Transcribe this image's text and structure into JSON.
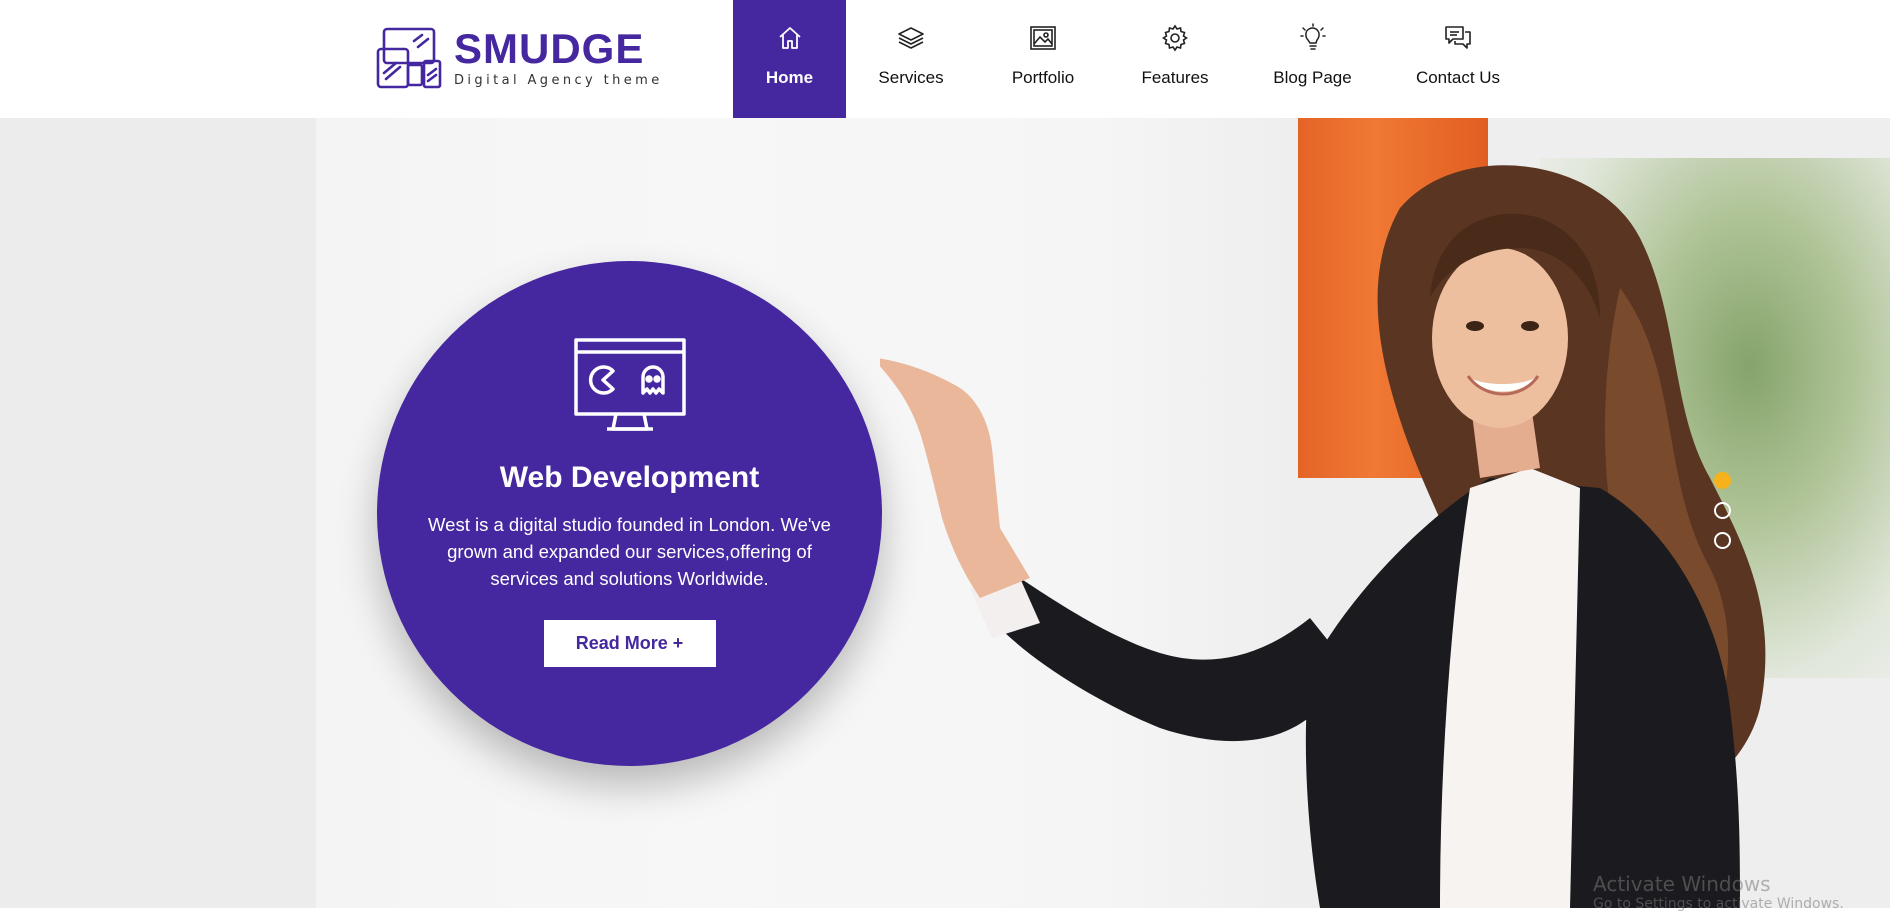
{
  "logo": {
    "name": "SMUDGE",
    "tagline": "Digital Agency theme"
  },
  "nav": {
    "items": [
      {
        "label": "Home",
        "icon": "home-icon",
        "active": true
      },
      {
        "label": "Services",
        "icon": "layers-icon",
        "active": false
      },
      {
        "label": "Portfolio",
        "icon": "image-icon",
        "active": false
      },
      {
        "label": "Features",
        "icon": "gear-icon",
        "active": false
      },
      {
        "label": "Blog Page",
        "icon": "lightbulb-icon",
        "active": false
      },
      {
        "label": "Contact Us",
        "icon": "chat-icon",
        "active": false
      }
    ]
  },
  "hero": {
    "card": {
      "icon": "monitor-game-icon",
      "title": "Web Development",
      "text": "West is a digital studio founded in London. We've grown and expanded our services,offering of services and solutions Worldwide.",
      "button_label": "Read More +"
    },
    "slider": {
      "slides": 3,
      "active_index": 0
    }
  },
  "watermark": {
    "title": "Activate Windows",
    "subtitle": "Go to Settings to activate Windows."
  },
  "colors": {
    "brand": "#45279f",
    "accent": "#f6b21a",
    "pillar": "#ec7030"
  }
}
